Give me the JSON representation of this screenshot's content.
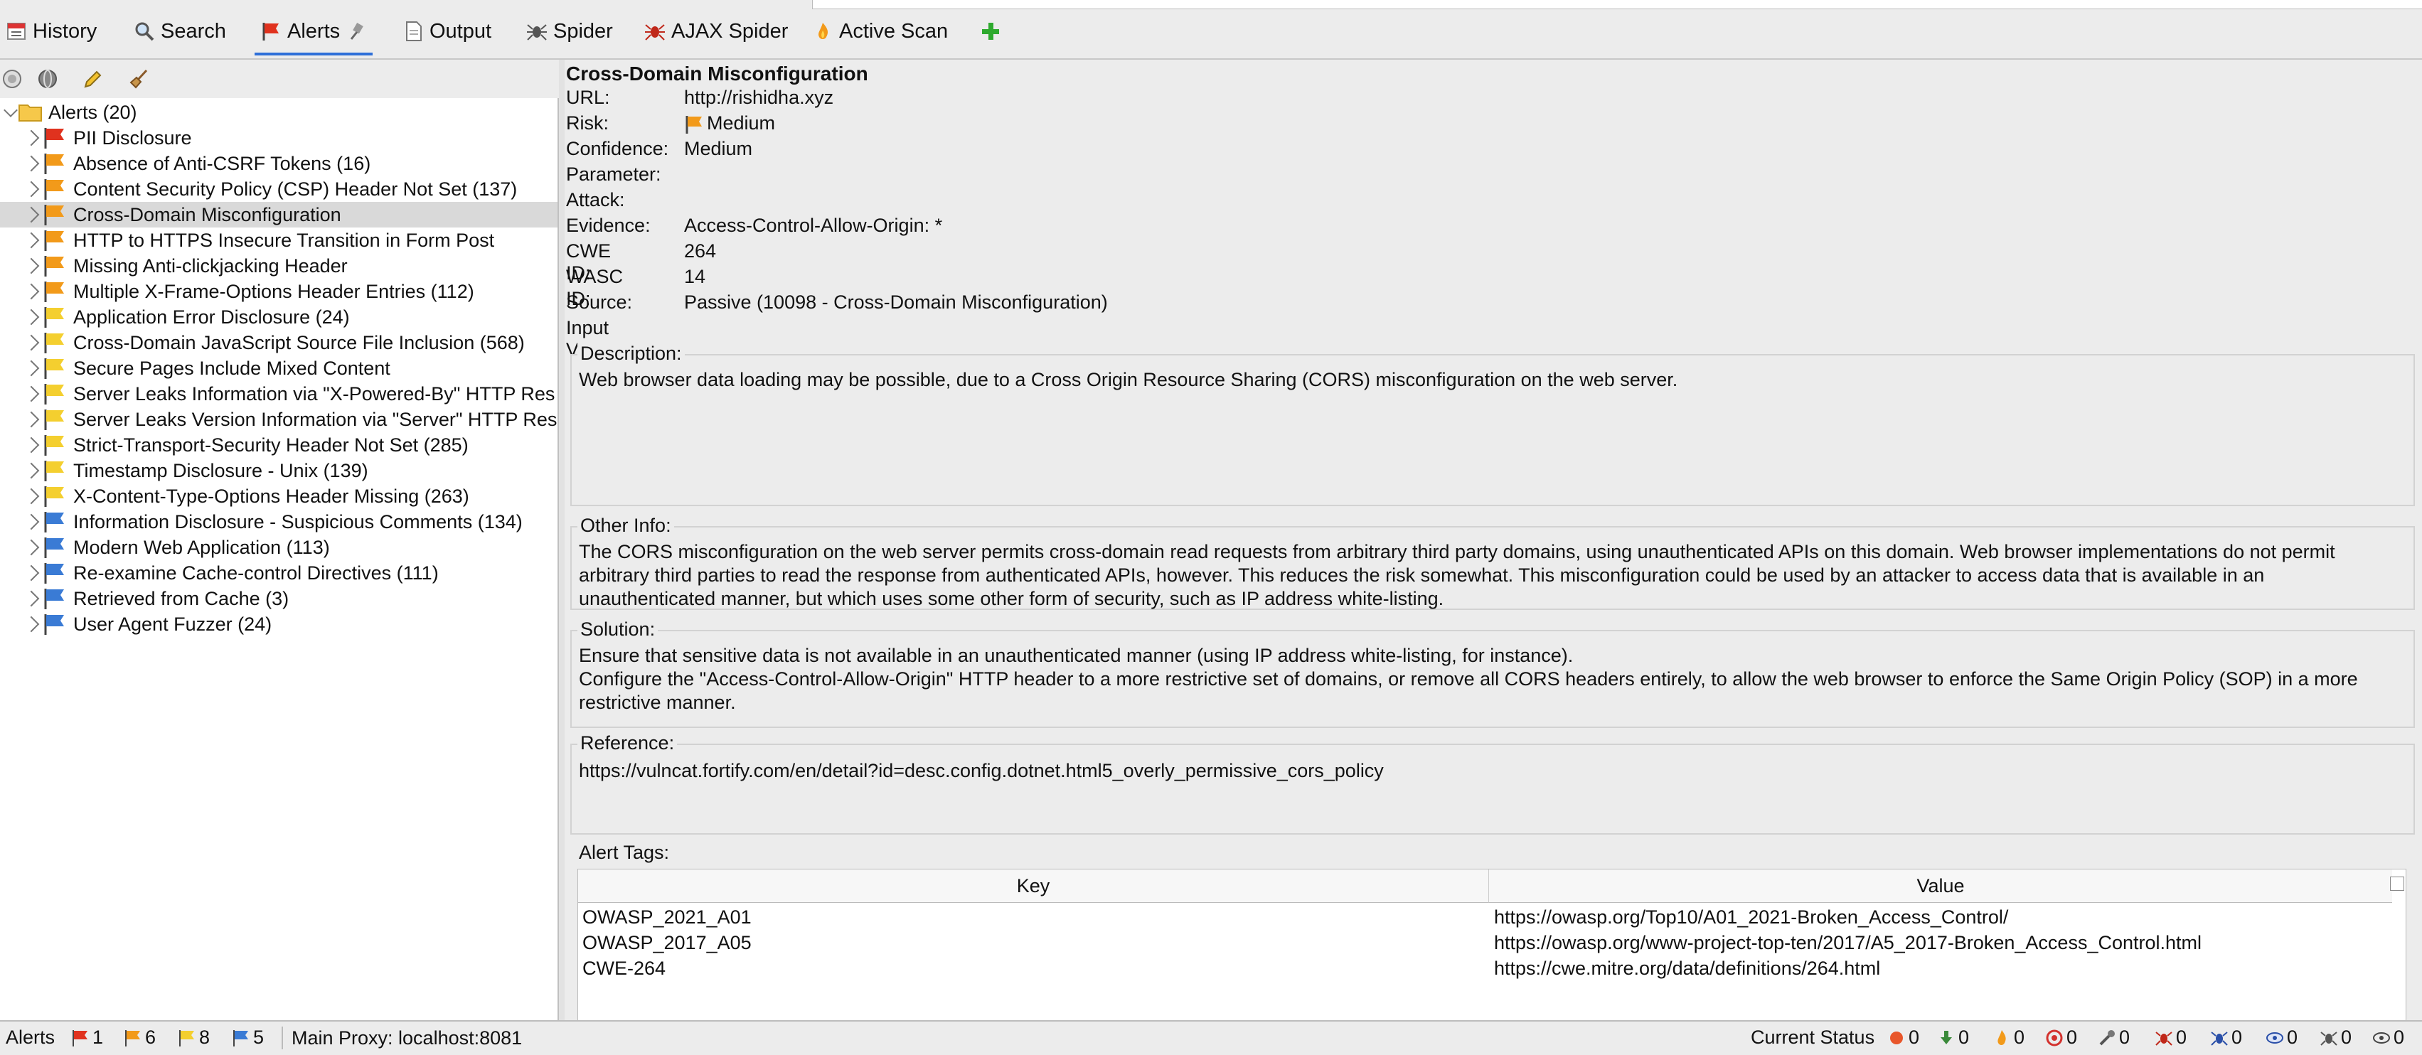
{
  "tabs": [
    {
      "label": "History",
      "icon": "history-icon"
    },
    {
      "label": "Search",
      "icon": "search-icon"
    },
    {
      "label": "Alerts",
      "icon": "alert-flag-icon"
    },
    {
      "label": "Output",
      "icon": "output-icon"
    },
    {
      "label": "Spider",
      "icon": "spider-icon"
    },
    {
      "label": "AJAX Spider",
      "icon": "ajax-spider-icon"
    },
    {
      "label": "Active Scan",
      "icon": "active-scan-icon"
    }
  ],
  "tree": {
    "root": "Alerts (20)",
    "items": [
      {
        "label": "PII Disclosure",
        "risk": "high"
      },
      {
        "label": "Absence of Anti-CSRF Tokens (16)",
        "risk": "medium"
      },
      {
        "label": "Content Security Policy (CSP) Header Not Set (137)",
        "risk": "medium"
      },
      {
        "label": "Cross-Domain Misconfiguration",
        "risk": "medium"
      },
      {
        "label": "HTTP to HTTPS Insecure Transition in Form Post",
        "risk": "medium"
      },
      {
        "label": "Missing Anti-clickjacking Header",
        "risk": "medium"
      },
      {
        "label": "Multiple X-Frame-Options Header Entries (112)",
        "risk": "medium"
      },
      {
        "label": "Application Error Disclosure (24)",
        "risk": "low"
      },
      {
        "label": "Cross-Domain JavaScript Source File Inclusion (568)",
        "risk": "low"
      },
      {
        "label": "Secure Pages Include Mixed Content",
        "risk": "low"
      },
      {
        "label": "Server Leaks Information via \"X-Powered-By\" HTTP Res",
        "risk": "low"
      },
      {
        "label": "Server Leaks Version Information via \"Server\" HTTP Res",
        "risk": "low"
      },
      {
        "label": "Strict-Transport-Security Header Not Set (285)",
        "risk": "low"
      },
      {
        "label": "Timestamp Disclosure - Unix (139)",
        "risk": "low"
      },
      {
        "label": "X-Content-Type-Options Header Missing (263)",
        "risk": "low"
      },
      {
        "label": "Information Disclosure - Suspicious Comments (134)",
        "risk": "info"
      },
      {
        "label": "Modern Web Application (113)",
        "risk": "info"
      },
      {
        "label": "Re-examine Cache-control Directives (111)",
        "risk": "info"
      },
      {
        "label": "Retrieved from Cache (3)",
        "risk": "info"
      },
      {
        "label": "User Agent Fuzzer (24)",
        "risk": "info"
      }
    ],
    "selected_index": 3
  },
  "detail": {
    "title": "Cross-Domain Misconfiguration",
    "fields": [
      {
        "key": "URL:",
        "value": "http://rishidha.xyz"
      },
      {
        "key": "Risk:",
        "value": "Medium"
      },
      {
        "key": "Confidence:",
        "value": "Medium"
      },
      {
        "key": "Parameter:",
        "value": ""
      },
      {
        "key": "Attack:",
        "value": ""
      },
      {
        "key": "Evidence:",
        "value": "Access-Control-Allow-Origin: *"
      },
      {
        "key": "CWE ID:",
        "value": "264"
      },
      {
        "key": "WASC ID:",
        "value": "14"
      },
      {
        "key": "Source:",
        "value": "Passive (10098 - Cross-Domain Misconfiguration)"
      },
      {
        "key": "Input Vector:",
        "value": ""
      }
    ],
    "description_label": "Description:",
    "description": "Web browser data loading may be possible, due to a Cross Origin Resource Sharing (CORS) misconfiguration on the web server.",
    "other_info_label": "Other Info:",
    "other_info": "The CORS misconfiguration on the web server permits cross-domain read requests from arbitrary third party domains, using unauthenticated APIs on this domain. Web browser implementations do not permit arbitrary third parties to read the response from authenticated APIs, however. This reduces the risk somewhat. This misconfiguration could be used by an attacker to access data that is available in an unauthenticated manner, but which uses some other form of security, such as IP address white-listing.",
    "solution_label": "Solution:",
    "solution_line1": "Ensure that sensitive data is not available in an unauthenticated manner (using IP address white-listing, for instance).",
    "solution_line2": "Configure the \"Access-Control-Allow-Origin\" HTTP header to a more restrictive set of domains, or remove all CORS headers entirely, to allow the web browser to enforce the Same Origin Policy (SOP) in a more restrictive manner.",
    "reference_label": "Reference:",
    "reference": "https://vulncat.fortify.com/en/detail?id=desc.config.dotnet.html5_overly_permissive_cors_policy",
    "tags_label": "Alert Tags:",
    "tags_header": {
      "key": "Key",
      "value": "Value"
    },
    "tags": [
      {
        "key": "OWASP_2021_A01",
        "value": "https://owasp.org/Top10/A01_2021-Broken_Access_Control/"
      },
      {
        "key": "OWASP_2017_A05",
        "value": "https://owasp.org/www-project-top-ten/2017/A5_2017-Broken_Access_Control.html"
      },
      {
        "key": "CWE-264",
        "value": "https://cwe.mitre.org/data/definitions/264.html"
      }
    ]
  },
  "statusbar": {
    "alerts_label": "Alerts",
    "alert_counts": {
      "high": "1",
      "medium": "6",
      "low": "8",
      "info": "5"
    },
    "proxy": "Main Proxy: localhost:8081",
    "current_status_label": "Current Status",
    "status_counts": [
      "0",
      "0",
      "0",
      "0",
      "0",
      "0",
      "0",
      "0",
      "0",
      "0"
    ]
  },
  "colors": {
    "high": "#e0321e",
    "medium": "#f29a1a",
    "low": "#f4cf2f",
    "info": "#3a7bd5"
  }
}
